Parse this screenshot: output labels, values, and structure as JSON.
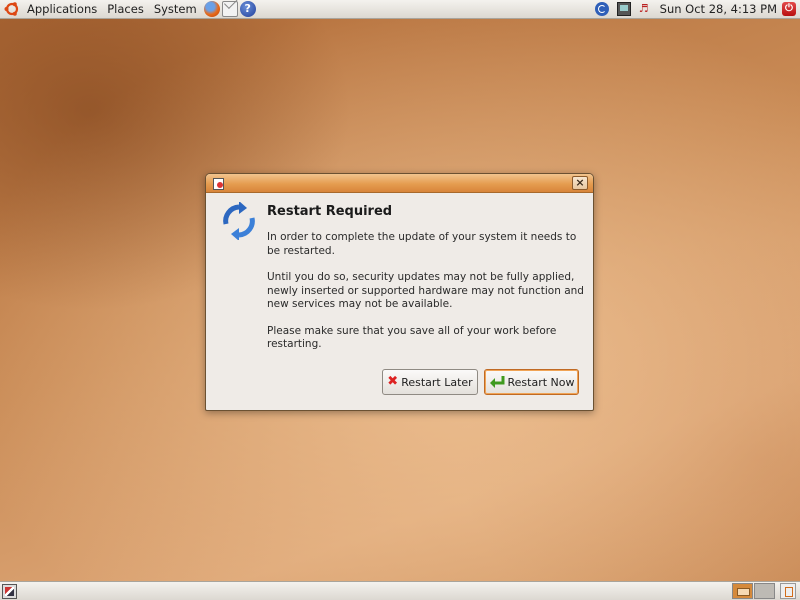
{
  "top_panel": {
    "menus": [
      "Applications",
      "Places",
      "System"
    ],
    "launchers": [
      "firefox-icon",
      "mail-icon",
      "help-icon"
    ],
    "tray": [
      "update-notifier-icon",
      "network-icon",
      "volume-icon"
    ],
    "clock": "Sun Oct 28,  4:13 PM",
    "help_glyph": "?"
  },
  "dialog": {
    "title": "Restart Required",
    "paragraphs": [
      "In order to complete the update of your system it needs to be restarted.",
      "Until you do so, security updates may not be fully applied, newly inserted or supported hardware may not function and new services may not be available.",
      "Please make sure that you save all of your work before restarting."
    ],
    "buttons": {
      "later": "Restart Later",
      "now": "Restart Now"
    },
    "close_glyph": "×"
  },
  "colors": {
    "titlebar": "#e59d50",
    "dialog_bg": "#efebe7",
    "desktop": "#c98b56",
    "default_button_border": "#c06a24"
  }
}
